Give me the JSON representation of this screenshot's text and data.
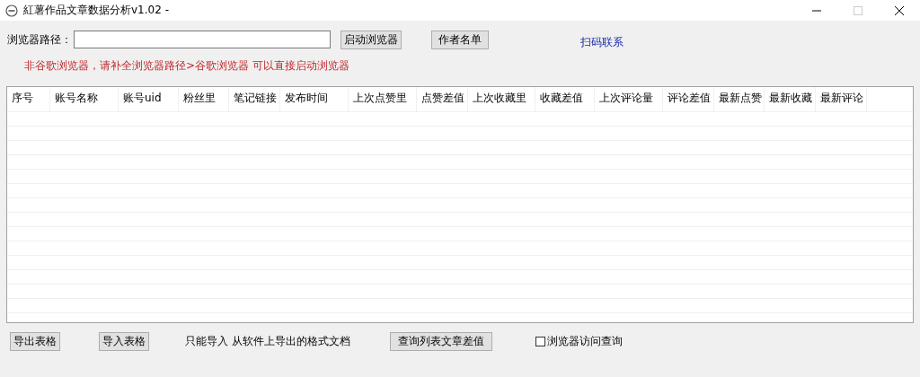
{
  "window": {
    "title": "紅薯作品文章数据分析v1.02 -"
  },
  "browser_path": {
    "label": "浏览器路径："
  },
  "top_buttons": [
    "启动浏览器",
    "作者名单"
  ],
  "contact_link": "扫码联系",
  "warning": "非谷歌浏览器，请补全浏览器路径>谷歌浏览器 可以直接启动浏览器",
  "table": {
    "columns": [
      {
        "label": "序号"
      },
      {
        "label": "账号名称"
      },
      {
        "label": "账号uid"
      },
      {
        "label": "粉丝里"
      },
      {
        "label": "笔记链接"
      },
      {
        "label": "发布时间"
      },
      {
        "label": "上次点赞里"
      },
      {
        "label": "点赞差值"
      },
      {
        "label": "上次收藏里"
      },
      {
        "label": "收藏差值"
      },
      {
        "label": "上次评论量"
      },
      {
        "label": "评论差值"
      },
      {
        "label": "最新点赞"
      },
      {
        "label": "最新收藏"
      },
      {
        "label": "最新评论"
      }
    ]
  },
  "bottom": {
    "export_button": "导出表格",
    "import_button": "导入表格",
    "import_note": "只能导入 从软件上导出的格式文档",
    "query_button": "查询列表文章差值",
    "browser_query": {
      "label": "浏览器访问查询",
      "checked": false
    }
  }
}
